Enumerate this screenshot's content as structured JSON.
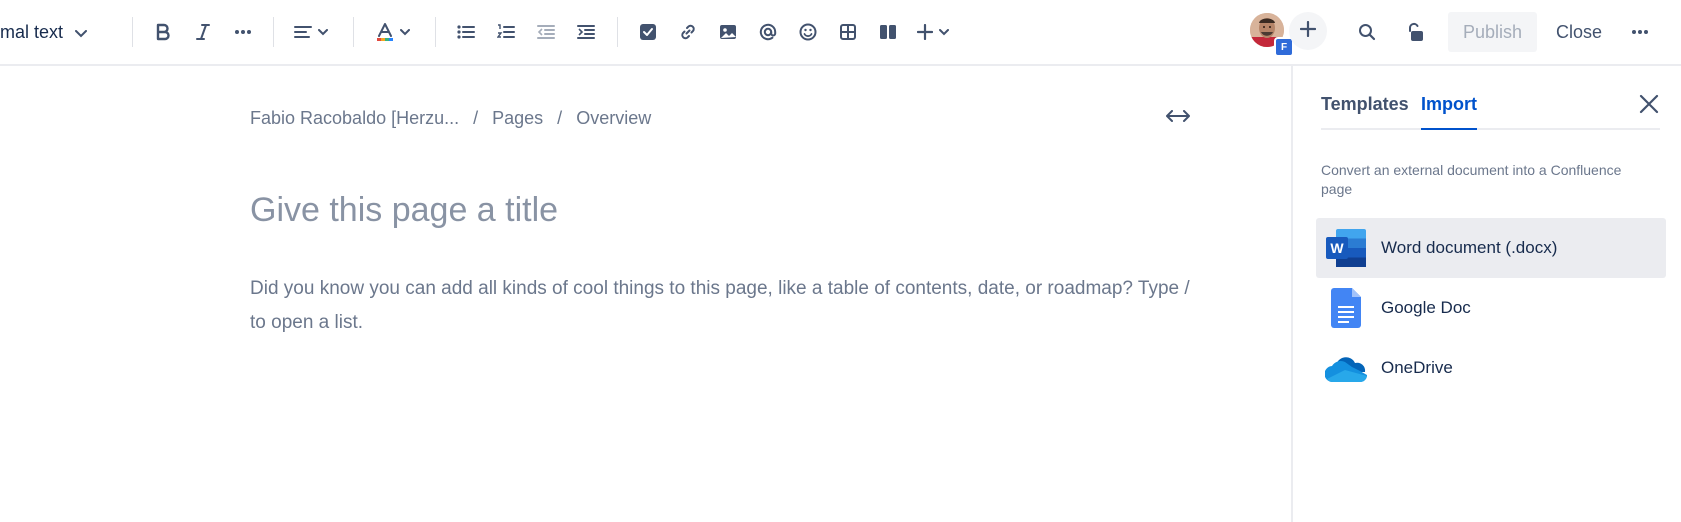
{
  "toolbar": {
    "text_style": "rmal text",
    "publish_label": "Publish",
    "close_label": "Close",
    "avatar_badge": "F"
  },
  "editor": {
    "breadcrumb": [
      "Fabio Racobaldo [Herzu...",
      "Pages",
      "Overview"
    ],
    "breadcrumb_separator": "/",
    "title_placeholder": "Give this page a title",
    "body_hint": "Did you know you can add all kinds of cool things to this page, like a table of contents, date, or roadmap? Type / to open a list."
  },
  "panel": {
    "tabs": [
      "Templates",
      "Import"
    ],
    "active_tab": "Import",
    "description": "Convert an external document into a Confluence page",
    "options": [
      {
        "label": "Word document (.docx)",
        "icon": "word-icon",
        "selected": true
      },
      {
        "label": "Google Doc",
        "icon": "google-doc-icon",
        "selected": false
      },
      {
        "label": "OneDrive",
        "icon": "onedrive-icon",
        "selected": false
      }
    ]
  },
  "colors": {
    "accent": "#0052CC",
    "text_primary": "#172B4D",
    "text_subtle": "#6B778C",
    "selected_bg": "#EBECF0",
    "publish_disabled_bg": "#F4F5F7"
  },
  "icons": {
    "word_letter": "W"
  }
}
